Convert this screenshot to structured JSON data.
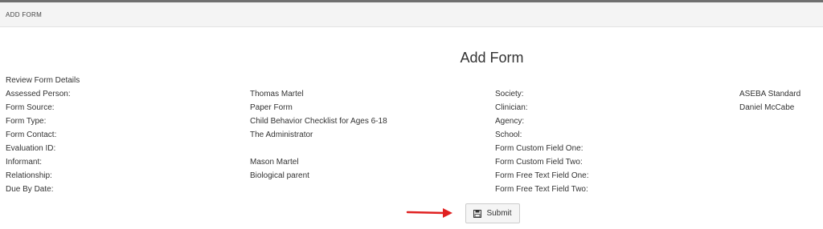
{
  "header": {
    "title": "ADD FORM"
  },
  "page": {
    "title": "Add Form"
  },
  "details": {
    "heading": "Review Form Details",
    "left_fields": [
      {
        "label": "Assessed Person:",
        "value": "Thomas Martel"
      },
      {
        "label": "Form Source:",
        "value": "Paper Form"
      },
      {
        "label": "Form Type:",
        "value": "Child Behavior Checklist for Ages 6-18"
      },
      {
        "label": "Form Contact:",
        "value": "The Administrator"
      },
      {
        "label": "Evaluation ID:",
        "value": ""
      },
      {
        "label": "Informant:",
        "value": "Mason Martel"
      },
      {
        "label": "Relationship:",
        "value": "Biological parent"
      },
      {
        "label": "Due By Date:",
        "value": ""
      }
    ],
    "right_fields": [
      {
        "label": "Society:",
        "value": "ASEBA Standard"
      },
      {
        "label": "Clinician:",
        "value": "Daniel McCabe"
      },
      {
        "label": "Agency:",
        "value": ""
      },
      {
        "label": "School:",
        "value": ""
      },
      {
        "label": "Form Custom Field One:",
        "value": ""
      },
      {
        "label": "Form Custom Field Two:",
        "value": ""
      },
      {
        "label": "Form Free Text Field One:",
        "value": ""
      },
      {
        "label": "Form Free Text Field Two:",
        "value": ""
      }
    ]
  },
  "actions": {
    "submit_label": "Submit",
    "submit_icon": "save-icon"
  },
  "annotation": {
    "arrow_icon": "red-arrow-icon",
    "arrow_color": "#e02020"
  }
}
